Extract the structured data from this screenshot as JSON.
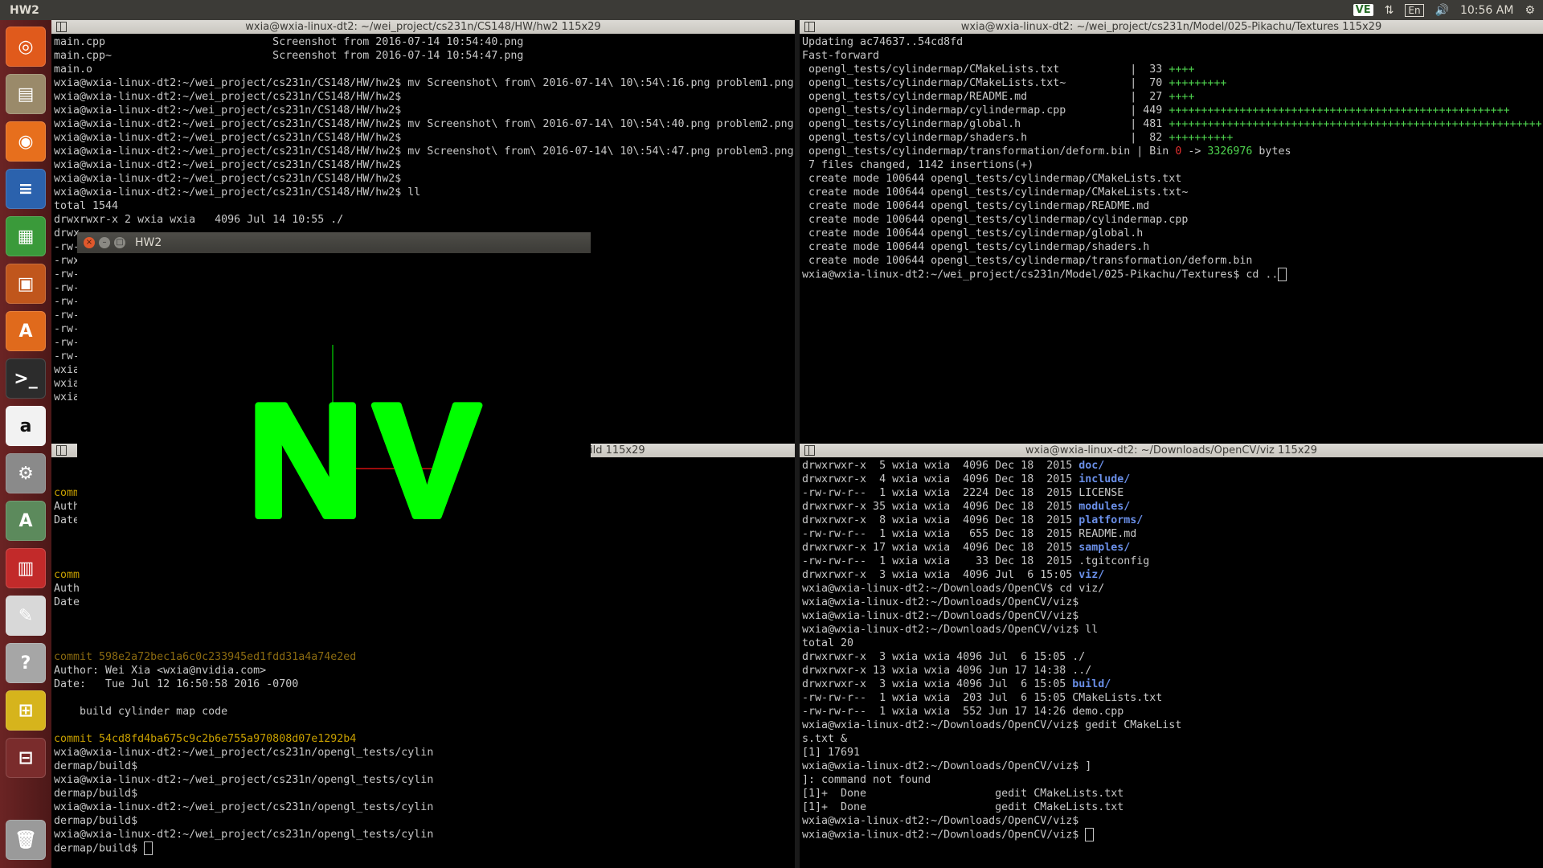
{
  "topbar": {
    "app_title": "HW2",
    "indicator_vpn": "VE",
    "indicator_lang": "En",
    "clock": "10:56 AM"
  },
  "launcher": {
    "items": [
      {
        "name": "dash-home",
        "glyph": "◎",
        "color": "#e05a1c"
      },
      {
        "name": "files",
        "glyph": "▤",
        "color": "#9a8a6a"
      },
      {
        "name": "firefox",
        "glyph": "◉",
        "color": "#e76f1d"
      },
      {
        "name": "writer",
        "glyph": "≡",
        "color": "#2b62ad"
      },
      {
        "name": "calc",
        "glyph": "▦",
        "color": "#3a9a3a"
      },
      {
        "name": "impress",
        "glyph": "▣",
        "color": "#c0561c"
      },
      {
        "name": "software-center",
        "glyph": "A",
        "color": "#e06a1c"
      },
      {
        "name": "terminal",
        "glyph": ">_",
        "color": "#2c2c2c"
      },
      {
        "name": "amazon",
        "glyph": "a",
        "color": "#f2f2f2"
      },
      {
        "name": "system-settings",
        "glyph": "⚙",
        "color": "#8a8a8a"
      },
      {
        "name": "software-updater",
        "glyph": "A",
        "color": "#5c8a5c"
      },
      {
        "name": "remmina",
        "glyph": "▥",
        "color": "#c22a2a"
      },
      {
        "name": "gedit",
        "glyph": "✎",
        "color": "#d8d8d8"
      },
      {
        "name": "help",
        "glyph": "?",
        "color": "#a6a6a6"
      },
      {
        "name": "workspace-switcher-active",
        "glyph": "⊞",
        "color": "#d6b41c"
      },
      {
        "name": "workspace-switcher",
        "glyph": "⊟",
        "color": "#7a2c2c"
      },
      {
        "name": "trash",
        "glyph": "🗑",
        "color": "#9a9a9a"
      }
    ]
  },
  "term_top_left": {
    "title": "wxia@wxia-linux-dt2: ~/wei_project/cs231n/CS148/HW/hw2 115x29",
    "lines": [
      "main.cpp                          Screenshot from 2016-07-14 10:54:40.png",
      "main.cpp~                         Screenshot from 2016-07-14 10:54:47.png",
      "main.o",
      "wxia@wxia-linux-dt2:~/wei_project/cs231n/CS148/HW/hw2$ mv Screenshot\\ from\\ 2016-07-14\\ 10\\:54\\:16.png problem1.png",
      "wxia@wxia-linux-dt2:~/wei_project/cs231n/CS148/HW/hw2$",
      "wxia@wxia-linux-dt2:~/wei_project/cs231n/CS148/HW/hw2$",
      "wxia@wxia-linux-dt2:~/wei_project/cs231n/CS148/HW/hw2$ mv Screenshot\\ from\\ 2016-07-14\\ 10\\:54\\:40.png problem2.png",
      "wxia@wxia-linux-dt2:~/wei_project/cs231n/CS148/HW/hw2$",
      "wxia@wxia-linux-dt2:~/wei_project/cs231n/CS148/HW/hw2$ mv Screenshot\\ from\\ 2016-07-14\\ 10\\:54\\:47.png problem3.png",
      "wxia@wxia-linux-dt2:~/wei_project/cs231n/CS148/HW/hw2$",
      "wxia@wxia-linux-dt2:~/wei_project/cs231n/CS148/HW/hw2$",
      "wxia@wxia-linux-dt2:~/wei_project/cs231n/CS148/HW/hw2$ ll",
      "total 1544",
      "drwxrwxr-x 2 wxia wxia   4096 Jul 14 10:55 ./",
      "drwx",
      "-rw-",
      "-rwx",
      "-rw-",
      "-rw-",
      "-rw-",
      "-rw-",
      "-rw-",
      "-rw-",
      "-rw-",
      "wxia",
      "wxia",
      "wxia"
    ]
  },
  "term_top_right": {
    "title": "wxia@wxia-linux-dt2: ~/wei_project/cs231n/Model/025-Pikachu/Textures 115x29",
    "lines": [
      {
        "t": "Updating ac74637..54cd8fd"
      },
      {
        "t": "Fast-forward"
      },
      {
        "t": " opengl_tests/cylindermap/CMakeLists.txt           |  33 ",
        "g": "++++"
      },
      {
        "t": " opengl_tests/cylindermap/CMakeLists.txt~          |  70 ",
        "g": "+++++++++"
      },
      {
        "t": " opengl_tests/cylindermap/README.md                |  27 ",
        "g": "++++"
      },
      {
        "t": " opengl_tests/cylindermap/cylindermap.cpp          | 449 ",
        "g": "+++++++++++++++++++++++++++++++++++++++++++++++++++++"
      },
      {
        "t": " opengl_tests/cylindermap/global.h                 | 481 ",
        "g": "++++++++++++++++++++++++++++++++++++++++++++++++++++++++++"
      },
      {
        "t": " opengl_tests/cylindermap/shaders.h                |  82 ",
        "g": "++++++++++"
      },
      {
        "t": " opengl_tests/cylindermap/transformation/deform.bin | Bin ",
        "r": "0",
        "t2": " -> ",
        "g": "3326976",
        "t3": " bytes"
      },
      {
        "t": " 7 files changed, 1142 insertions(+)"
      },
      {
        "t": " create mode 100644 opengl_tests/cylindermap/CMakeLists.txt"
      },
      {
        "t": " create mode 100644 opengl_tests/cylindermap/CMakeLists.txt~"
      },
      {
        "t": " create mode 100644 opengl_tests/cylindermap/README.md"
      },
      {
        "t": " create mode 100644 opengl_tests/cylindermap/cylindermap.cpp"
      },
      {
        "t": " create mode 100644 opengl_tests/cylindermap/global.h"
      },
      {
        "t": " create mode 100644 opengl_tests/cylindermap/shaders.h"
      },
      {
        "t": " create mode 100644 opengl_tests/cylindermap/transformation/deform.bin"
      },
      {
        "t": "wxia@wxia-linux-dt2:~/wei_project/cs231n/Model/025-Pikachu/Textures$ cd ..",
        "cursor": true
      }
    ]
  },
  "term_bottom_left": {
    "title_fragment": "ild 115x29",
    "lines": [
      {
        "t": ""
      },
      {
        "t": ""
      },
      {
        "t": "comm",
        "c": "yellow"
      },
      {
        "t": "Auth"
      },
      {
        "t": "Date"
      },
      {
        "t": ""
      },
      {
        "t": ""
      },
      {
        "t": ""
      },
      {
        "t": "comm",
        "c": "yellow"
      },
      {
        "t": "Auth"
      },
      {
        "t": "Date"
      },
      {
        "t": ""
      },
      {
        "t": ""
      },
      {
        "t": ""
      },
      {
        "t": "commit 598e2a72bec1a6c0c233945ed1fdd31a4a74e2ed",
        "c": "dim"
      },
      {
        "t": "Author: Wei Xia <wxia@nvidia.com>"
      },
      {
        "t": "Date:   Tue Jul 12 16:50:58 2016 -0700"
      },
      {
        "t": ""
      },
      {
        "t": "    build cylinder map code"
      },
      {
        "t": ""
      },
      {
        "t": "commit 54cd8fd4ba675c9c2b6e755a970808d07e1292b4",
        "c": "yellow"
      },
      {
        "t": "wxia@wxia-linux-dt2:~/wei_project/cs231n/opengl_tests/cylin"
      },
      {
        "t": "dermap/build$"
      },
      {
        "t": "wxia@wxia-linux-dt2:~/wei_project/cs231n/opengl_tests/cylin"
      },
      {
        "t": "dermap/build$"
      },
      {
        "t": "wxia@wxia-linux-dt2:~/wei_project/cs231n/opengl_tests/cylin"
      },
      {
        "t": "dermap/build$"
      },
      {
        "t": "wxia@wxia-linux-dt2:~/wei_project/cs231n/opengl_tests/cylin"
      },
      {
        "t": "dermap/build$ ",
        "cursor": true
      }
    ]
  },
  "term_bottom_right": {
    "title": "wxia@wxia-linux-dt2: ~/Downloads/OpenCV/viz 115x29",
    "lines": [
      {
        "t": "drwxrwxr-x  5 wxia wxia  4096 Dec 18  2015 ",
        "b": "doc/"
      },
      {
        "t": "drwxrwxr-x  4 wxia wxia  4096 Dec 18  2015 ",
        "b": "include/"
      },
      {
        "t": "-rw-rw-r--  1 wxia wxia  2224 Dec 18  2015 LICENSE"
      },
      {
        "t": "drwxrwxr-x 35 wxia wxia  4096 Dec 18  2015 ",
        "b": "modules/"
      },
      {
        "t": "drwxrwxr-x  8 wxia wxia  4096 Dec 18  2015 ",
        "b": "platforms/"
      },
      {
        "t": "-rw-rw-r--  1 wxia wxia   655 Dec 18  2015 README.md"
      },
      {
        "t": "drwxrwxr-x 17 wxia wxia  4096 Dec 18  2015 ",
        "b": "samples/"
      },
      {
        "t": "-rw-rw-r--  1 wxia wxia    33 Dec 18  2015 .tgitconfig"
      },
      {
        "t": "drwxrwxr-x  3 wxia wxia  4096 Jul  6 15:05 ",
        "b": "viz/"
      },
      {
        "t": "wxia@wxia-linux-dt2:~/Downloads/OpenCV$ cd viz/"
      },
      {
        "t": "wxia@wxia-linux-dt2:~/Downloads/OpenCV/viz$"
      },
      {
        "t": "wxia@wxia-linux-dt2:~/Downloads/OpenCV/viz$"
      },
      {
        "t": "wxia@wxia-linux-dt2:~/Downloads/OpenCV/viz$ ll"
      },
      {
        "t": "total 20"
      },
      {
        "t": "drwxrwxr-x  3 wxia wxia 4096 Jul  6 15:05 ./"
      },
      {
        "t": "drwxrwxr-x 13 wxia wxia 4096 Jun 17 14:38 ../"
      },
      {
        "t": "drwxrwxr-x  3 wxia wxia 4096 Jul  6 15:05 ",
        "b": "build/"
      },
      {
        "t": "-rw-rw-r--  1 wxia wxia  203 Jul  6 15:05 CMakeLists.txt"
      },
      {
        "t": "-rw-rw-r--  1 wxia wxia  552 Jun 17 14:26 demo.cpp"
      },
      {
        "t": "wxia@wxia-linux-dt2:~/Downloads/OpenCV/viz$ gedit CMakeList"
      },
      {
        "t": "s.txt &"
      },
      {
        "t": "[1] 17691"
      },
      {
        "t": "wxia@wxia-linux-dt2:~/Downloads/OpenCV/viz$ ]"
      },
      {
        "t": "]: command not found"
      },
      {
        "t": "[1]+  Done                    gedit CMakeLists.txt"
      },
      {
        "t": "[1]+  Done                    gedit CMakeLists.txt"
      },
      {
        "t": "wxia@wxia-linux-dt2:~/Downloads/OpenCV/viz$"
      },
      {
        "t": "wxia@wxia-linux-dt2:~/Downloads/OpenCV/viz$ ",
        "cursor": true
      }
    ]
  },
  "hw2_window": {
    "title": "HW2",
    "text": "NV",
    "text_color": "#00ff00"
  }
}
